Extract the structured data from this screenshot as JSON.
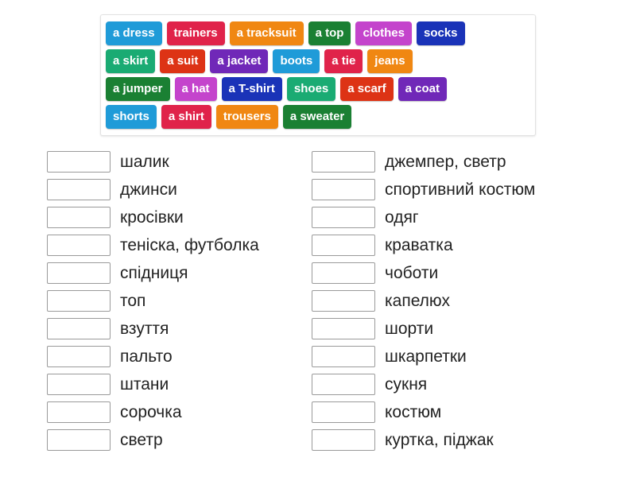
{
  "word_bank": {
    "rows": [
      [
        {
          "label": "a dress",
          "color": "#1f9bd8"
        },
        {
          "label": "trainers",
          "color": "#e0234a"
        },
        {
          "label": "a tracksuit",
          "color": "#f08712"
        },
        {
          "label": "a top",
          "color": "#1a8033"
        },
        {
          "label": "clothes",
          "color": "#c444cc"
        },
        {
          "label": "socks",
          "color": "#1a33b8"
        }
      ],
      [
        {
          "label": "a skirt",
          "color": "#1aab73"
        },
        {
          "label": "a suit",
          "color": "#dd3315"
        },
        {
          "label": "a jacket",
          "color": "#7028b8"
        },
        {
          "label": "boots",
          "color": "#1f9bd8"
        },
        {
          "label": "a tie",
          "color": "#e0234a"
        },
        {
          "label": "jeans",
          "color": "#f08712"
        }
      ],
      [
        {
          "label": "a jumper",
          "color": "#1a8033"
        },
        {
          "label": "a hat",
          "color": "#c444cc"
        },
        {
          "label": "a T-shirt",
          "color": "#1a33b8"
        },
        {
          "label": "shoes",
          "color": "#1aab73"
        },
        {
          "label": "a scarf",
          "color": "#dd3315"
        },
        {
          "label": "a coat",
          "color": "#7028b8"
        }
      ],
      [
        {
          "label": "shorts",
          "color": "#1f9bd8"
        },
        {
          "label": "a shirt",
          "color": "#e0234a"
        },
        {
          "label": "trousers",
          "color": "#f08712"
        },
        {
          "label": "a sweater",
          "color": "#1a8033"
        }
      ]
    ]
  },
  "answers": {
    "left_column": [
      {
        "box_value": "",
        "label": "шалик"
      },
      {
        "box_value": "",
        "label": "джинси"
      },
      {
        "box_value": "",
        "label": "кросівки"
      },
      {
        "box_value": "",
        "label": "теніска, футболка"
      },
      {
        "box_value": "",
        "label": "спідниця"
      },
      {
        "box_value": "",
        "label": "топ"
      },
      {
        "box_value": "",
        "label": "взуття"
      },
      {
        "box_value": "",
        "label": "пальто"
      },
      {
        "box_value": "",
        "label": "штани"
      },
      {
        "box_value": "",
        "label": "сорочка"
      },
      {
        "box_value": "",
        "label": "светр"
      }
    ],
    "right_column": [
      {
        "box_value": "",
        "label": "джемпер, светр"
      },
      {
        "box_value": "",
        "label": "спортивний костюм"
      },
      {
        "box_value": "",
        "label": "одяг"
      },
      {
        "box_value": "",
        "label": "краватка"
      },
      {
        "box_value": "",
        "label": "чоботи"
      },
      {
        "box_value": "",
        "label": "капелюх"
      },
      {
        "box_value": "",
        "label": "шорти"
      },
      {
        "box_value": "",
        "label": "шкарпетки"
      },
      {
        "box_value": "",
        "label": "сукня"
      },
      {
        "box_value": "",
        "label": "костюм"
      },
      {
        "box_value": "",
        "label": "куртка, піджак"
      }
    ]
  }
}
